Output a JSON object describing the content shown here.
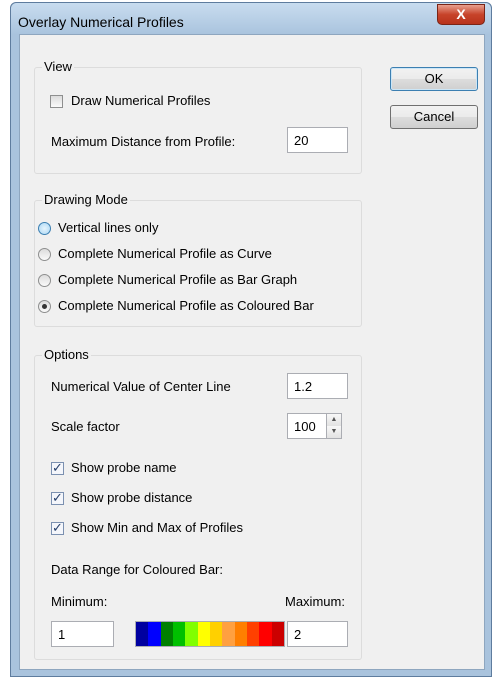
{
  "window": {
    "title": "Overlay Numerical Profiles",
    "close_label": "X"
  },
  "buttons": {
    "ok": "OK",
    "cancel": "Cancel"
  },
  "view": {
    "label": "View",
    "draw_profiles": {
      "label": "Draw Numerical Profiles",
      "checked": false
    },
    "max_distance": {
      "label": "Maximum Distance from Profile:",
      "value": "20"
    }
  },
  "drawing_mode": {
    "label": "Drawing Mode",
    "options": [
      {
        "label": "Vertical lines only",
        "selected": false
      },
      {
        "label": "Complete Numerical Profile as Curve",
        "selected": false
      },
      {
        "label": "Complete Numerical Profile as Bar Graph",
        "selected": false
      },
      {
        "label": "Complete Numerical Profile as Coloured Bar",
        "selected": true
      }
    ]
  },
  "options": {
    "label": "Options",
    "center_line": {
      "label": "Numerical Value of Center Line",
      "value": "1.2"
    },
    "scale_factor": {
      "label": "Scale factor",
      "value": "100"
    },
    "show_probe_name": {
      "label": "Show probe name",
      "checked": true
    },
    "show_probe_distance": {
      "label": "Show probe distance",
      "checked": true
    },
    "show_min_max": {
      "label": "Show Min and Max of Profiles",
      "checked": true
    },
    "data_range_label": "Data Range for Coloured Bar:",
    "minimum": {
      "label": "Minimum:",
      "value": "1"
    },
    "maximum": {
      "label": "Maximum:",
      "value": "2"
    },
    "colorbar_colors": [
      "#0000a0",
      "#0000ff",
      "#008000",
      "#00c000",
      "#80ff00",
      "#ffff00",
      "#ffd000",
      "#ffa040",
      "#ff7f00",
      "#ff4000",
      "#ff0000",
      "#cc0000"
    ]
  }
}
